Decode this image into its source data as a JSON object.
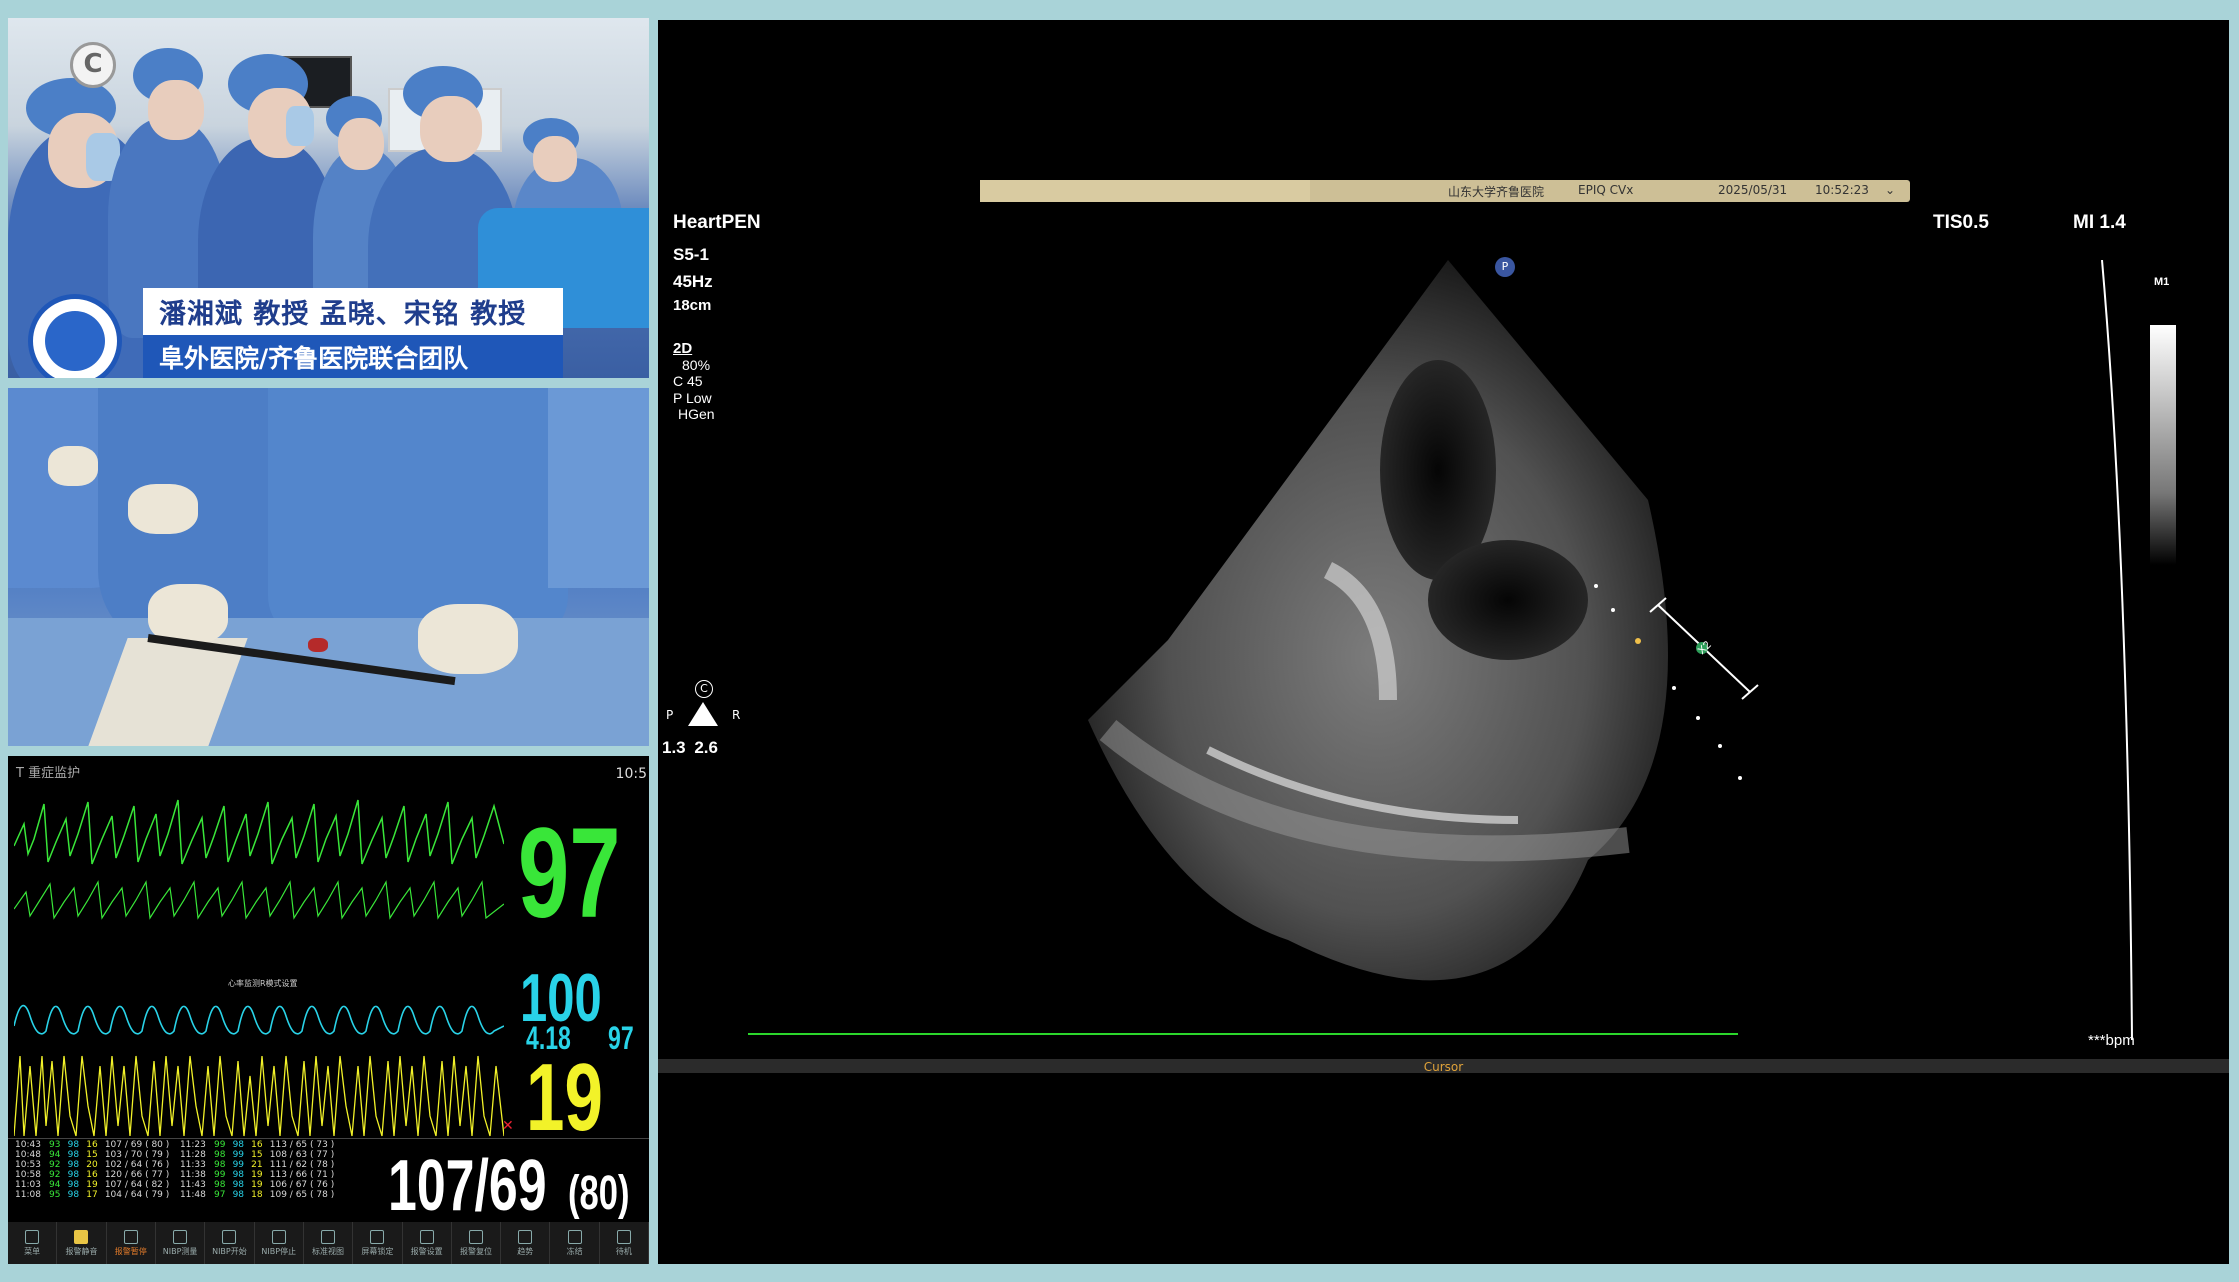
{
  "camera_top": {
    "caption_line1": "潘湘斌 教授  孟晓、宋铭 教授",
    "caption_line2": "阜外医院/齐鲁医院联合团队",
    "badge": "C"
  },
  "monitor": {
    "top_left": "T 重症监护",
    "time": "10:5",
    "wave_label_mid": "心率监测R模式设置",
    "hr_value": "97",
    "spo2_value": "100",
    "pi_value": "4.18",
    "pr_value": "97",
    "resp_value": "19",
    "bp_value": "107/69",
    "map_value": "(80)",
    "colors": {
      "hr": "#39e639",
      "spo2": "#29d3e8",
      "resp": "#f2f229",
      "bp": "#ffffff"
    },
    "table_rows": [
      [
        "10:43",
        "93",
        "98",
        "16",
        "107 / 69 ( 80 )",
        "11:23",
        "99",
        "98",
        "16",
        "113 / 65 ( 73 )"
      ],
      [
        "10:48",
        "94",
        "98",
        "15",
        "103 / 70 ( 79 )",
        "11:28",
        "98",
        "99",
        "15",
        "108 / 63 ( 77 )"
      ],
      [
        "10:53",
        "92",
        "98",
        "20",
        "102 / 64 ( 76 )",
        "11:33",
        "98",
        "99",
        "21",
        "111 / 62 ( 78 )"
      ],
      [
        "10:58",
        "92",
        "98",
        "16",
        "120 / 66 ( 77 )",
        "11:38",
        "99",
        "98",
        "19",
        "113 / 66 ( 71 )"
      ],
      [
        "11:03",
        "94",
        "98",
        "19",
        "107 / 64 ( 82 )",
        "11:43",
        "98",
        "98",
        "19",
        "106 / 67 ( 76 )"
      ],
      [
        "11:08",
        "95",
        "98",
        "17",
        "104 / 64 ( 79 )",
        "11:48",
        "97",
        "98",
        "18",
        "109 / 65 ( 78 )"
      ]
    ],
    "bottom_buttons": [
      "菜单",
      "报警静音",
      "报警暂停",
      "NIBP测量",
      "NIBP开始",
      "NIBP停止",
      "标准视图",
      "屏幕锁定",
      "报警设置",
      "报警复位",
      "趋势",
      "冻结",
      "待机"
    ]
  },
  "ultrasound": {
    "header_hospital": "山东大学齐鲁医院",
    "header_device": "EPIQ CVx",
    "header_date": "2025/05/31",
    "header_time": "10:52:23",
    "probe_brand": "HeartPEN",
    "probe": "S5-1",
    "frame_rate": "45Hz",
    "depth": "18cm",
    "mode": "2D",
    "gain": "80%",
    "compress": "C 45",
    "power": "P Low",
    "harmonic": "HGen",
    "tis": "TIS0.5",
    "mi": "MI 1.4",
    "scale_label": "M1",
    "orientation_p": "P",
    "orientation_r": "R",
    "orientation_c": "C",
    "zoom_values": "1.3  2.6",
    "marker": "P",
    "caliper": "X2",
    "bpm": "***bpm",
    "cursor": "Cursor"
  }
}
